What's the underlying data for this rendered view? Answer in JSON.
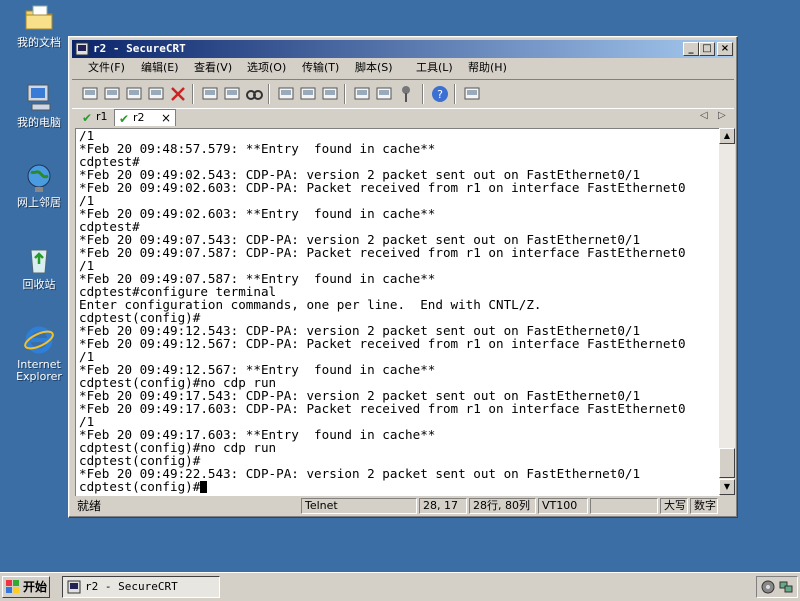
{
  "desktop": {
    "icons": [
      {
        "label": "我的文档",
        "icon": "folder-documents-icon"
      },
      {
        "label": "我的电脑",
        "icon": "computer-icon"
      },
      {
        "label": "网上邻居",
        "icon": "network-icon"
      },
      {
        "label": "回收站",
        "icon": "recycle-bin-icon"
      },
      {
        "label": "Internet Explorer",
        "icon": "internet-explorer-icon"
      }
    ]
  },
  "window": {
    "title": "r2 - SecureCRT",
    "menu": [
      "文件(F)",
      "编辑(E)",
      "查看(V)",
      "选项(O)",
      "传输(T)",
      "脚本(S)",
      "工具(L)",
      "帮助(H)"
    ],
    "toolbar_icons": [
      "connect-icon",
      "quick-connect-icon",
      "connect-tab-icon",
      "reconnect-icon",
      "disconnect-icon",
      "copy-icon",
      "paste-icon",
      "find-icon",
      "print-icon",
      "print-selection-icon",
      "print-setup-icon",
      "session-options-icon",
      "global-options-icon",
      "keymap-icon",
      "help-icon",
      "sftp-icon"
    ],
    "tabs": [
      {
        "label": "r1",
        "active": false
      },
      {
        "label": "r2",
        "active": true,
        "close": "×"
      }
    ],
    "tab_nav": {
      "prev": "◁",
      "next": "▷"
    },
    "terminal_lines": [
      "/1",
      "*Feb 20 09:48:57.579: **Entry  found in cache**",
      "cdptest#",
      "*Feb 20 09:49:02.543: CDP-PA: version 2 packet sent out on FastEthernet0/1",
      "*Feb 20 09:49:02.603: CDP-PA: Packet received from r1 on interface FastEthernet0",
      "/1",
      "*Feb 20 09:49:02.603: **Entry  found in cache**",
      "cdptest#",
      "*Feb 20 09:49:07.543: CDP-PA: version 2 packet sent out on FastEthernet0/1",
      "*Feb 20 09:49:07.587: CDP-PA: Packet received from r1 on interface FastEthernet0",
      "/1",
      "*Feb 20 09:49:07.587: **Entry  found in cache**",
      "cdptest#configure terminal",
      "Enter configuration commands, one per line.  End with CNTL/Z.",
      "cdptest(config)#",
      "*Feb 20 09:49:12.543: CDP-PA: version 2 packet sent out on FastEthernet0/1",
      "*Feb 20 09:49:12.567: CDP-PA: Packet received from r1 on interface FastEthernet0",
      "/1",
      "*Feb 20 09:49:12.567: **Entry  found in cache**",
      "cdptest(config)#no cdp run",
      "*Feb 20 09:49:17.543: CDP-PA: version 2 packet sent out on FastEthernet0/1",
      "*Feb 20 09:49:17.603: CDP-PA: Packet received from r1 on interface FastEthernet0",
      "/1",
      "*Feb 20 09:49:17.603: **Entry  found in cache**",
      "cdptest(config)#no cdp run",
      "cdptest(config)#",
      "*Feb 20 09:49:22.543: CDP-PA: version 2 packet sent out on FastEthernet0/1"
    ],
    "prompt_line": "cdptest(config)#",
    "status": {
      "ready": "就绪",
      "protocol": "Telnet",
      "cursor_pos": "28, 17",
      "size": "28行, 80列",
      "emulation": "VT100",
      "caps": "大写",
      "num": "数字"
    }
  },
  "taskbar": {
    "start_label": "开始",
    "task_label": "r2 - SecureCRT"
  },
  "colors": {
    "desktop": "#3a6ea5",
    "titlebar_start": "#0a246a",
    "titlebar_end": "#a6caf0",
    "chrome": "#d4d0c8"
  }
}
